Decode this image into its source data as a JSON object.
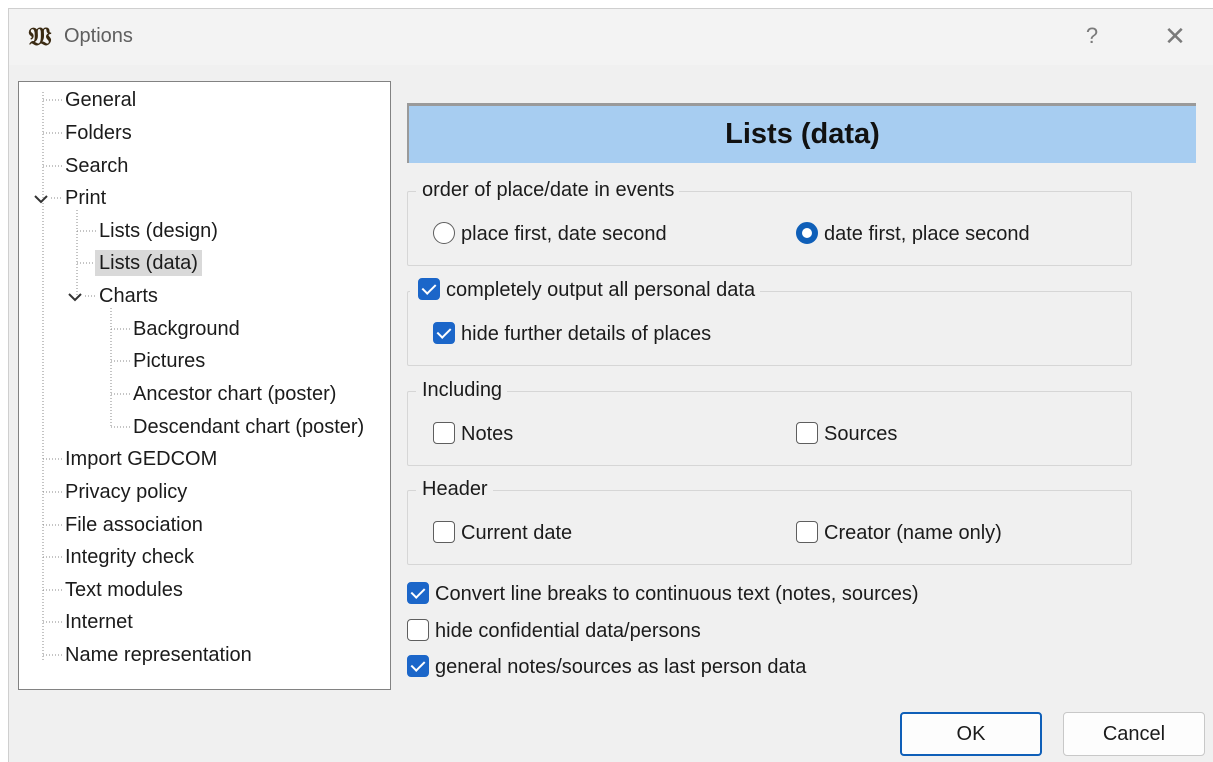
{
  "window": {
    "title": "Options",
    "help_glyph": "?",
    "close_glyph": "✕",
    "app_icon_glyph": "𝔚"
  },
  "tree": {
    "items": [
      {
        "label": "General"
      },
      {
        "label": "Folders"
      },
      {
        "label": "Search"
      },
      {
        "label": "Print"
      },
      {
        "label": "Lists (design)"
      },
      {
        "label": "Lists (data)"
      },
      {
        "label": "Charts"
      },
      {
        "label": "Background"
      },
      {
        "label": "Pictures"
      },
      {
        "label": "Ancestor chart (poster)"
      },
      {
        "label": "Descendant chart (poster)"
      },
      {
        "label": "Import GEDCOM"
      },
      {
        "label": "Privacy policy"
      },
      {
        "label": "File association"
      },
      {
        "label": "Integrity check"
      },
      {
        "label": "Text modules"
      },
      {
        "label": "Internet"
      },
      {
        "label": "Name representation"
      }
    ],
    "selected": "Lists (data)"
  },
  "panel": {
    "heading": "Lists (data)",
    "order_group": {
      "legend": "order of place/date in events",
      "options": [
        {
          "label": "place first, date second",
          "checked": false
        },
        {
          "label": "date first, place second",
          "checked": true
        }
      ]
    },
    "personal_group": {
      "legend": "completely output all personal data",
      "legend_checked": true,
      "hide_places_label": "hide further details of places",
      "hide_places_checked": true
    },
    "including_group": {
      "legend": "Including",
      "notes_label": "Notes",
      "notes_checked": false,
      "sources_label": "Sources",
      "sources_checked": false
    },
    "header_group": {
      "legend": "Header",
      "current_date_label": "Current date",
      "current_date_checked": false,
      "creator_label": "Creator (name only)",
      "creator_checked": false
    },
    "convert_label": "Convert line breaks to continuous text (notes, sources)",
    "convert_checked": true,
    "hide_confidential_label": "hide confidential data/persons",
    "hide_confidential_checked": false,
    "general_notes_label": "general notes/sources as last person data",
    "general_notes_checked": true
  },
  "buttons": {
    "ok": "OK",
    "cancel": "Cancel"
  },
  "colors": {
    "accent": "#0f5fb8",
    "header_bg": "#a7cdf1",
    "selection_bg": "#d9d9d9"
  }
}
